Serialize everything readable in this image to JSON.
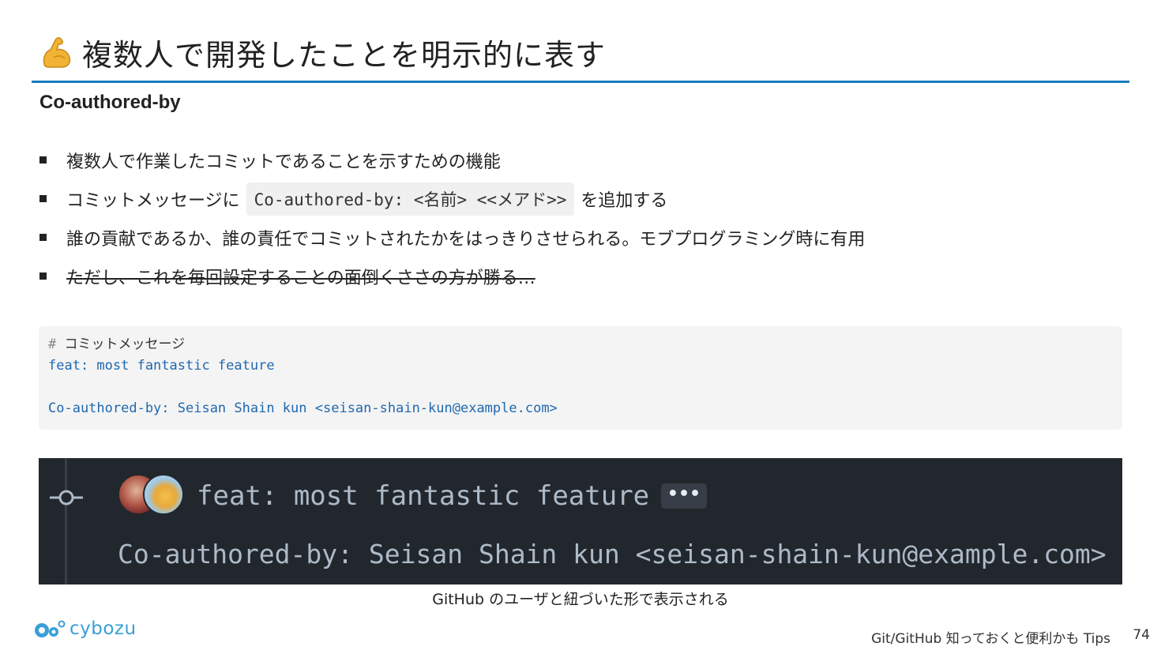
{
  "title": {
    "emoji_icon": "flexed-biceps-icon",
    "text": "複数人で開発したことを明示的に表す"
  },
  "subheading": "Co-authored-by",
  "bullets": {
    "b1": "複数人で作業したコミットであることを示すための機能",
    "b2_before": "コミットメッセージに",
    "b2_code": "Co-authored-by: <名前> <<メアド>>",
    "b2_after": "を追加する",
    "b3": "誰の貢献であるか、誰の責任でコミットされたかをはっきりさせられる。モブプログラミング時に有用",
    "b4": "ただし、これを毎回設定することの面倒くささの方が勝る…"
  },
  "code_block": {
    "comment_mark": "#",
    "comment_text": "コミットメッセージ",
    "line1": "feat: most fantastic feature",
    "line3": "Co-authored-by: Seisan Shain kun <seisan-shain-kun@example.com>"
  },
  "github_panel": {
    "commit_title": "feat: most fantastic feature",
    "ellipsis": "•••",
    "coauthor_line": "Co-authored-by: Seisan Shain kun <seisan-shain-kun@example.com>"
  },
  "caption": "GitHub のユーザと紐づいた形で表示される",
  "footer": {
    "logo_text": "cybozu",
    "deck_title": "Git/GitHub 知っておくと便利かも Tips",
    "page_number": "74"
  },
  "colors": {
    "title_rule": "#1a7bbf",
    "code_blue": "#2068b0",
    "panel_bg": "#22272e",
    "logo_blue": "#3a9fd8"
  }
}
